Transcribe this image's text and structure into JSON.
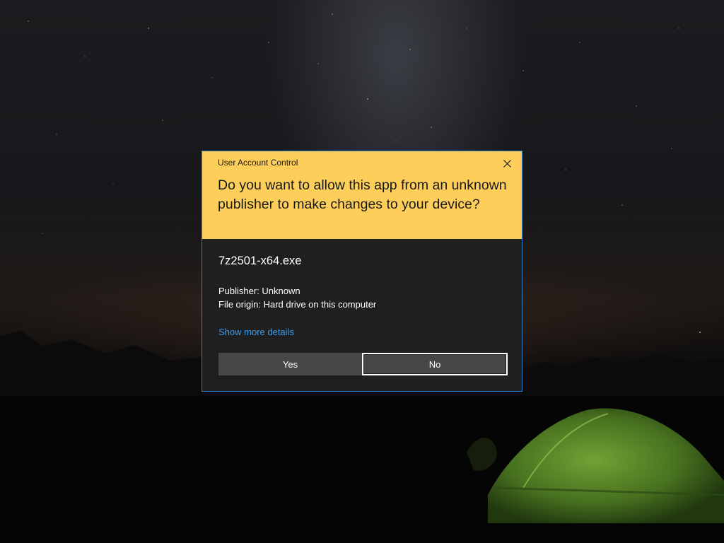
{
  "uac": {
    "title": "User Account Control",
    "question": "Do you want to allow this app from an unknown publisher to make changes to your device?",
    "app_name": "7z2501-x64.exe",
    "publisher": "Publisher: Unknown",
    "file_origin": "File origin: Hard drive on this computer",
    "more_details": "Show more details",
    "yes_label": "Yes",
    "no_label": "No",
    "close_icon": "close-icon"
  },
  "colors": {
    "header_background": "#fece5a",
    "body_background": "#1f1f1f",
    "border": "#2c7ec9",
    "link": "#3f9bea",
    "button_background": "#474747",
    "focus_outline": "#ffffff"
  }
}
